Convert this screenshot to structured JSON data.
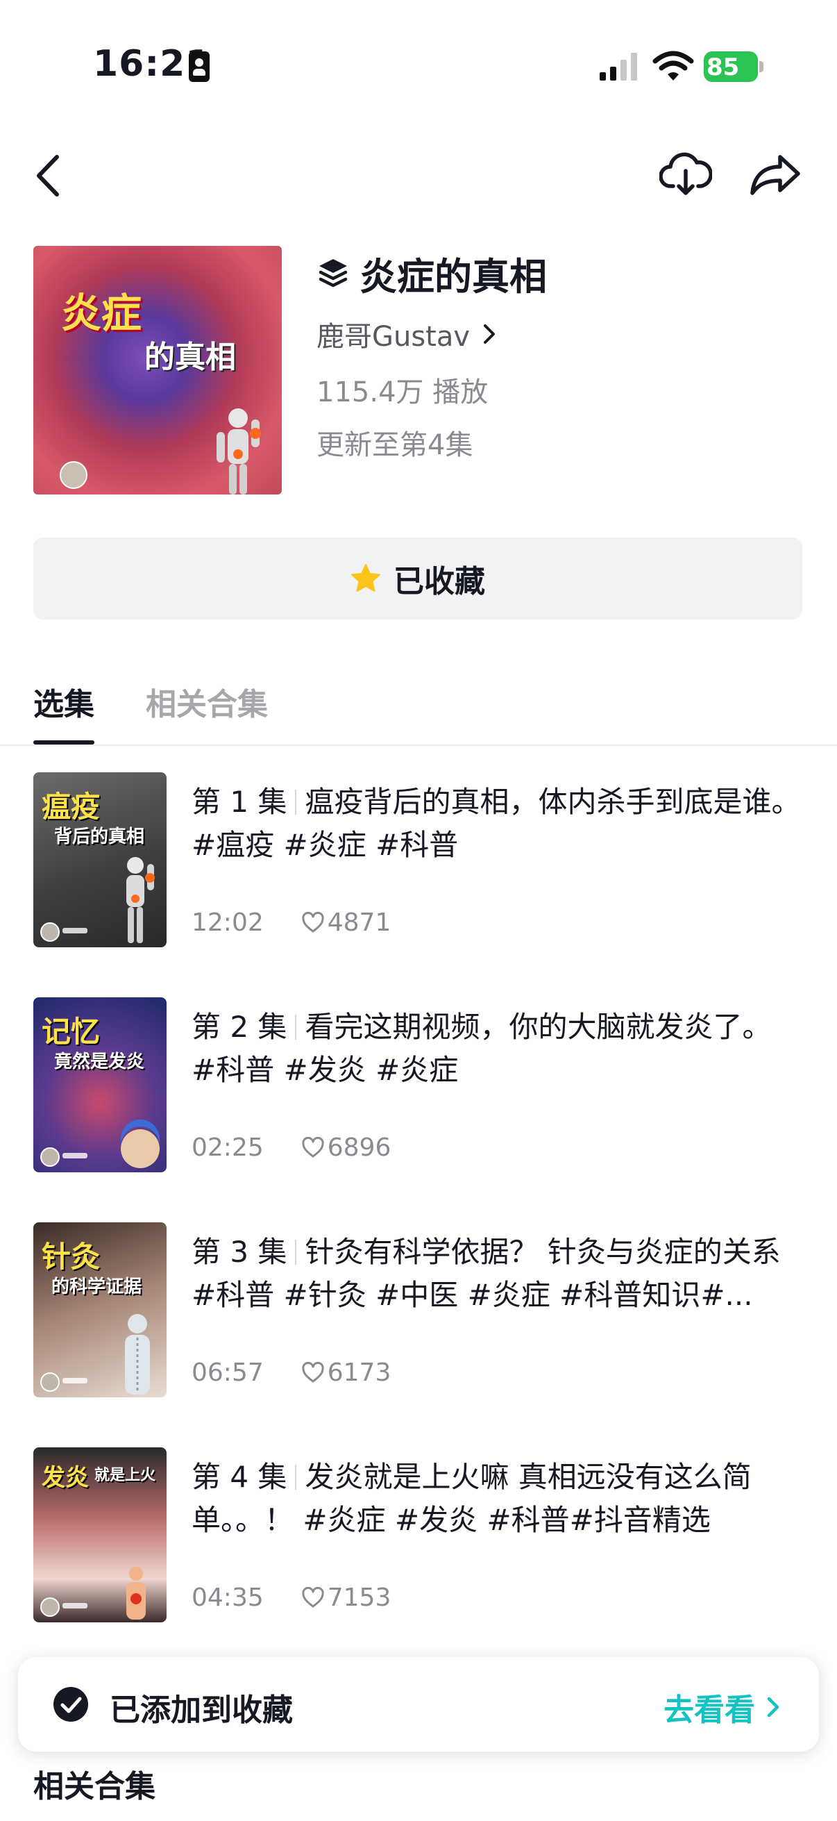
{
  "status_bar": {
    "time": "16:21",
    "battery": "85"
  },
  "header": {
    "back_icon": "chevron-left-icon",
    "download_icon": "cloud-download-icon",
    "share_icon": "share-arrow-icon"
  },
  "album": {
    "cover_title": "炎症",
    "cover_subtitle": "的真相",
    "title": "炎症的真相",
    "author": "鹿哥Gustav",
    "plays": "115.4万 播放",
    "updated": "更新至第4集",
    "favorite_label": "已收藏"
  },
  "tabs": [
    {
      "label": "选集",
      "active": true
    },
    {
      "label": "相关合集",
      "active": false
    }
  ],
  "episodes": [
    {
      "number": "第 1 集",
      "title": "瘟疫背后的真相，体内杀手到底是谁。 #瘟疫 #炎症 #科普",
      "duration": "12:02",
      "likes": "4871",
      "thumb_title": "瘟疫",
      "thumb_subtitle": "背后的真相"
    },
    {
      "number": "第 2 集",
      "title": "看完这期视频，你的大脑就发炎了。 #科普  #发炎  #炎症",
      "duration": "02:25",
      "likes": "6896",
      "thumb_title": "记忆",
      "thumb_subtitle": "竟然是发炎"
    },
    {
      "number": "第 3 集",
      "title": "针灸有科学依据？ 针灸与炎症的关系 #科普 #针灸 #中医  #炎症 #科普知识#...",
      "duration": "06:57",
      "likes": "6173",
      "thumb_title": "针灸",
      "thumb_subtitle": "的科学证据"
    },
    {
      "number": "第 4 集",
      "title": "发炎就是上火嘛 真相远没有这么简单。。！ #炎症 #发炎 #科普#抖音精选",
      "duration": "04:35",
      "likes": "7153",
      "thumb_title": "发炎",
      "thumb_subtitle": "就是上火"
    }
  ],
  "toast": {
    "message": "已添加到收藏",
    "link": "去看看"
  },
  "related_section": {
    "title": "相关合集"
  },
  "colors": {
    "accent": "#13c2c2",
    "star": "#fcc419",
    "battery": "#2bc453"
  }
}
